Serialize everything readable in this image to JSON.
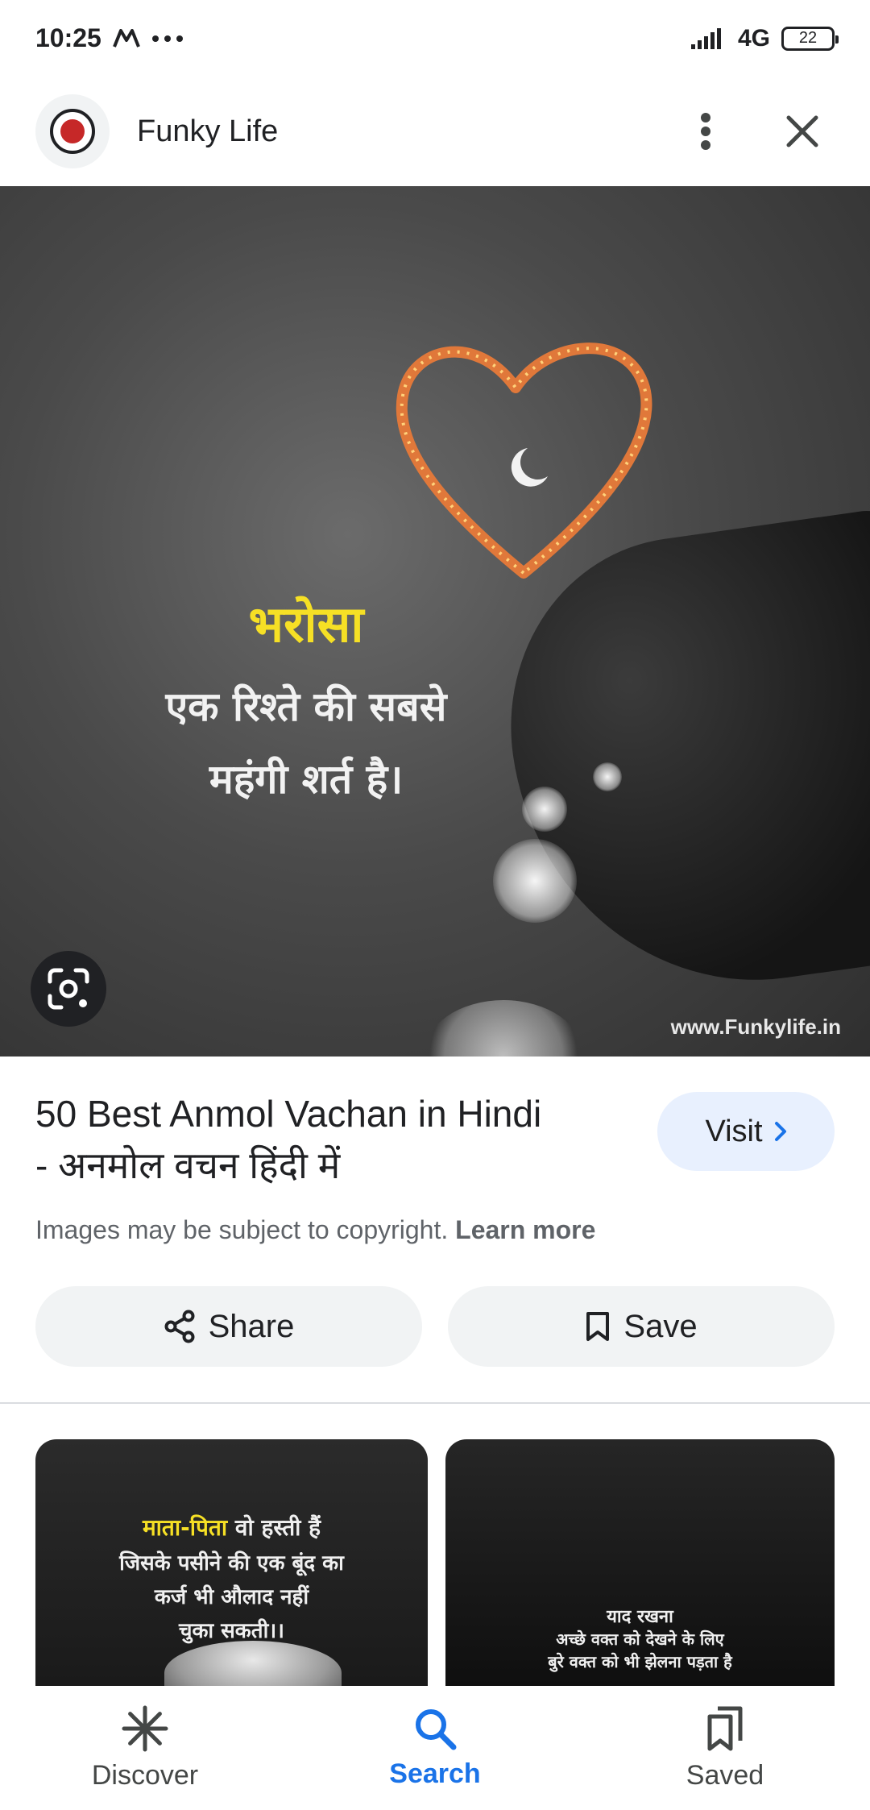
{
  "status_bar": {
    "time": "10:25",
    "network": "4G",
    "battery": "22"
  },
  "header": {
    "site_name": "Funky Life"
  },
  "hero": {
    "quote_title": "भरोसा",
    "quote_line_1": "एक रिश्ते की सबसे",
    "quote_line_2": "महंगी शर्त है।",
    "watermark": "www.Funkylife.in"
  },
  "result": {
    "title_line_1": "50 Best Anmol Vachan in Hindi",
    "title_line_2": "- अनमोल वचन हिंदी में",
    "visit_label": "Visit",
    "copyright_text": "Images may be subject to copyright.",
    "learn_more": "Learn more"
  },
  "actions": {
    "share_label": "Share",
    "save_label": "Save"
  },
  "related": [
    {
      "highlight": "माता-पिता",
      "line_1_rest": " वो हस्ती हैं",
      "line_2": "जिसके पसीने की एक बूंद का",
      "line_3": "कर्ज भी औलाद नहीं",
      "line_4": "चुका सकती।।"
    },
    {
      "line_1": "याद रखना",
      "line_2": "अच्छे वक्त को देखने के लिए",
      "line_3": "बुरे वक्त को भी झेलना पड़ता है"
    }
  ],
  "bottom_nav": {
    "items": [
      {
        "label": "Discover",
        "icon": "asterisk-icon"
      },
      {
        "label": "Search",
        "icon": "search-icon"
      },
      {
        "label": "Saved",
        "icon": "bookmarks-icon"
      }
    ],
    "active": "Search",
    "active_color": "#1a73e8"
  }
}
